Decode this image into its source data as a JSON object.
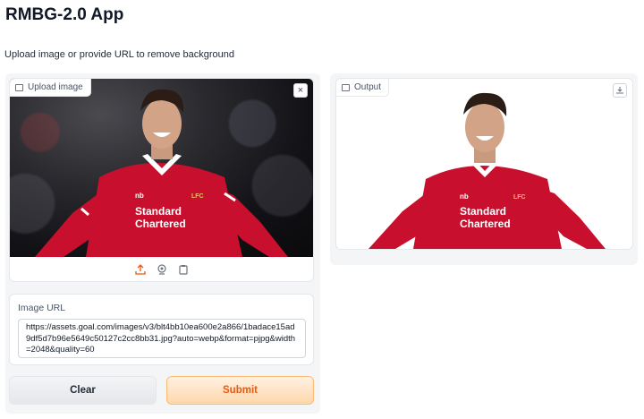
{
  "app": {
    "title": "RMBG-2.0 App",
    "description": "Upload image or provide URL to remove background"
  },
  "input_image": {
    "label": "Upload image",
    "clear_symbol": "×",
    "tools": [
      "upload-icon",
      "webcam-icon",
      "clipboard-icon"
    ]
  },
  "url": {
    "label": "Image URL",
    "value": "https://assets.goal.com/images/v3/blt4bb10ea600e2a866/1badace15ad9df5d7b96e5649c50127c2cc8bb31.jpg?auto=webp&format=pjpg&width=2048&quality=60"
  },
  "buttons": {
    "clear": "Clear",
    "submit": "Submit"
  },
  "output_image": {
    "label": "Output"
  },
  "shirt": {
    "sponsor_line1": "Standard",
    "sponsor_line2": "Chartered",
    "brand": "nb",
    "crest": "LFC"
  },
  "colors": {
    "accent": "#ea580c",
    "jersey": "#c8102e"
  }
}
